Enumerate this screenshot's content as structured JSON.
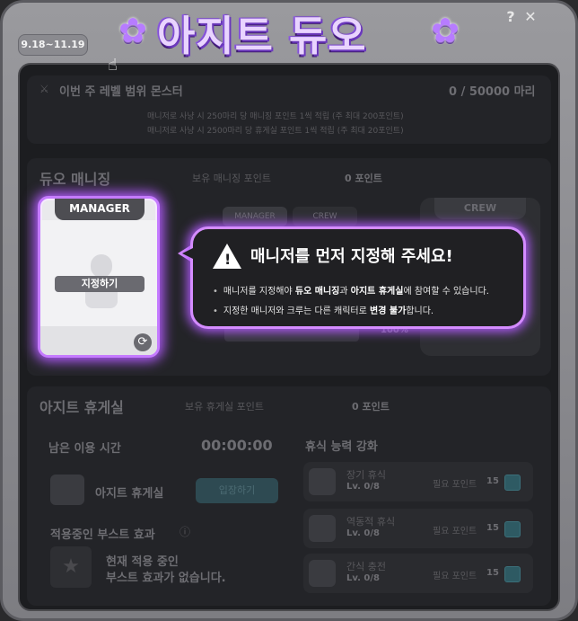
{
  "header": {
    "date_range": "9.18~11.19",
    "title": "아지트 듀오",
    "help_label": "?",
    "close_label": "✕"
  },
  "monster_section": {
    "title": "이번 주 레벨 범위 몬스터",
    "progress": "0 / 50000 마리",
    "note1": "매니저로 사냥 시 250마리 당 매니징 포인트 1씩 적립 (주 최대 200포인트)",
    "note2": "매니저로 사냥 시 2500마리 당 휴게실 포인트 1씩 적립 (주 최대 20포인트)"
  },
  "duo_managing": {
    "title": "듀오 매니징",
    "points_label": "보유 매니징 포인트",
    "points_value": "0 포인트",
    "tab_manager": "MANAGER",
    "tab_crew": "CREW",
    "percent": "100%"
  },
  "manager_card": {
    "header": "MANAGER",
    "assign_label": "지정하기"
  },
  "crew_card": {
    "header": "CREW"
  },
  "tooltip": {
    "title": "매니저를 먼저 지정해 주세요!",
    "line1_pre": "매니저를 지정해야 ",
    "line1_b1": "듀오 매니징",
    "line1_mid": "과 ",
    "line1_b2": "아지트 휴게실",
    "line1_post": "에 참여할 수 있습니다.",
    "line2_pre": "지정한 매니저와 크루는 다른 캐릭터로 ",
    "line2_b": "변경 불가",
    "line2_post": "합니다."
  },
  "lounge": {
    "title": "아지트 휴게실",
    "points_label": "보유 휴게실 포인트",
    "points_value": "0 포인트",
    "remaining_label": "남은 이용 시간",
    "remaining_value": "00:00:00",
    "room_label": "아지트 휴게실",
    "enter_label": "입장하기",
    "boost_title": "적용중인 부스트 효과",
    "boost_empty1": "현재 적용 중인",
    "boost_empty2": "부스트 효과가 없습니다."
  },
  "rest_upgrade": {
    "title": "휴식 능력 강화",
    "items": [
      {
        "name": "장기 휴식",
        "level": "Lv. 0/8",
        "cost_label": "필요 포인트",
        "cost": "15"
      },
      {
        "name": "역동적 휴식",
        "level": "Lv. 0/8",
        "cost_label": "필요 포인트",
        "cost": "15"
      },
      {
        "name": "간식 충전",
        "level": "Lv. 0/8",
        "cost_label": "필요 포인트",
        "cost": "15"
      }
    ]
  }
}
